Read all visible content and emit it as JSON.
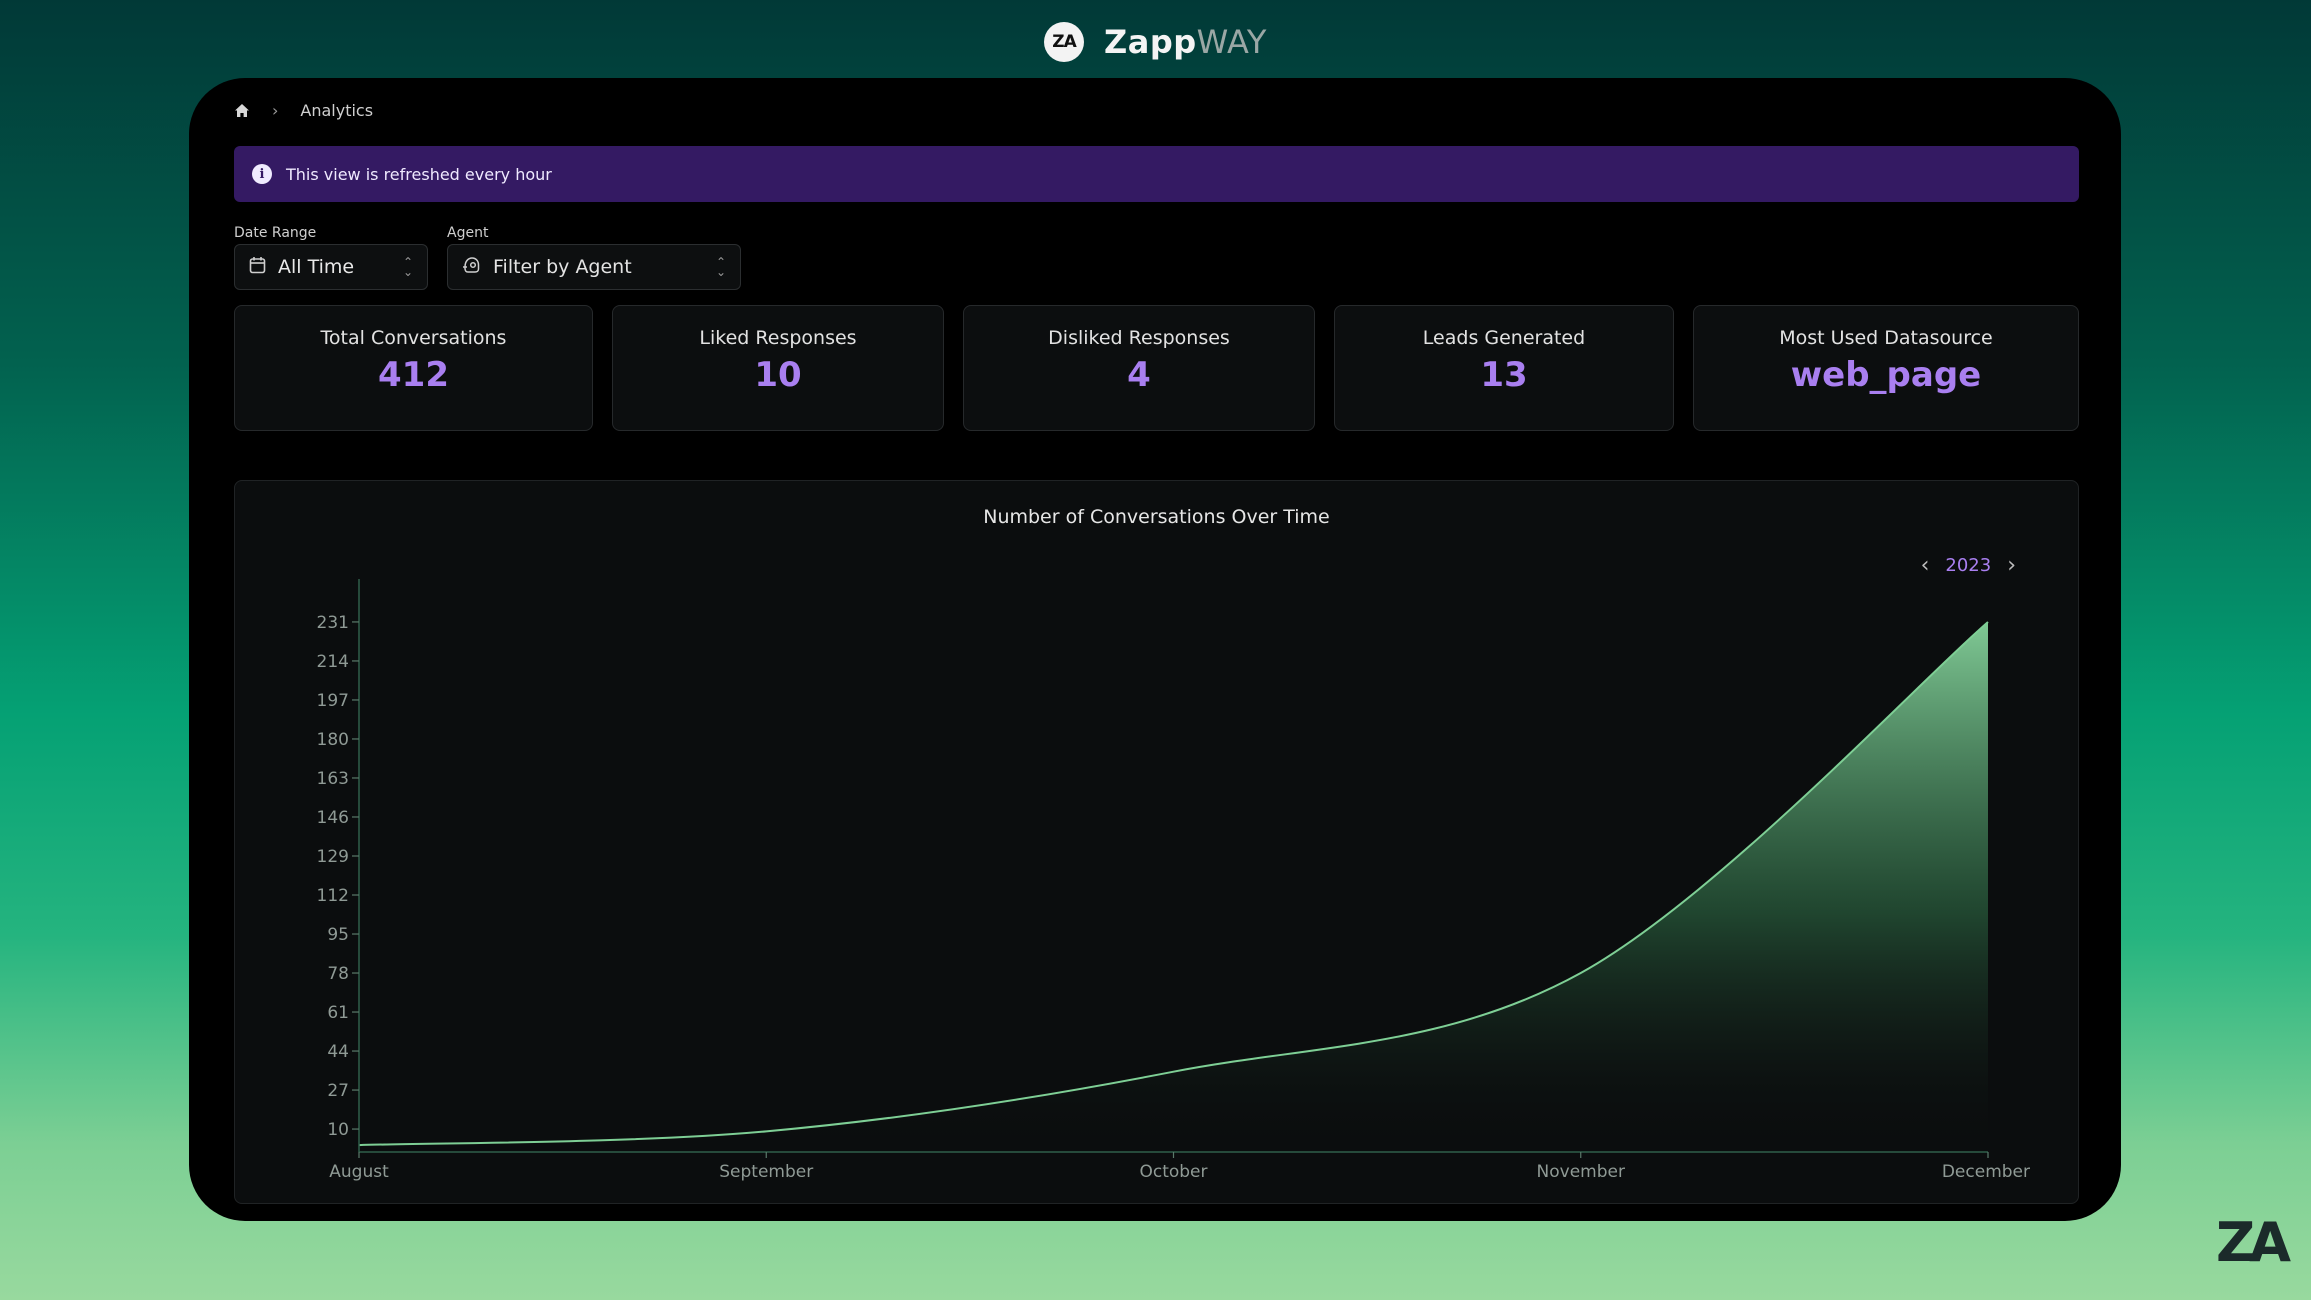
{
  "brand": {
    "logo_text": "ZA",
    "name_main": "Zapp",
    "name_dim": "WAY"
  },
  "breadcrumb": {
    "current": "Analytics"
  },
  "banner": {
    "message": "This view is refreshed every hour"
  },
  "filters": {
    "date_range": {
      "label": "Date Range",
      "value": "All Time"
    },
    "agent": {
      "label": "Agent",
      "placeholder": "Filter by Agent"
    }
  },
  "stats": [
    {
      "label": "Total Conversations",
      "value": "412"
    },
    {
      "label": "Liked Responses",
      "value": "10"
    },
    {
      "label": "Disliked Responses",
      "value": "4"
    },
    {
      "label": "Leads Generated",
      "value": "13"
    },
    {
      "label": "Most Used Datasource",
      "value": "web_page"
    }
  ],
  "chart": {
    "title": "Number of Conversations Over Time",
    "year": "2023",
    "accent": "#a97ff0",
    "line_color": "#7ecf95"
  },
  "chart_data": {
    "type": "area",
    "title": "Number of Conversations Over Time",
    "x": [
      "August",
      "September",
      "October",
      "November",
      "December"
    ],
    "values": [
      3,
      9,
      35,
      78,
      231
    ],
    "yticks": [
      10,
      27,
      44,
      61,
      78,
      95,
      112,
      129,
      146,
      163,
      180,
      197,
      214,
      231
    ],
    "ylim": [
      0,
      241
    ],
    "grid": false,
    "xlabel": "",
    "ylabel": ""
  },
  "corner_logo": {
    "text": "ZA"
  }
}
